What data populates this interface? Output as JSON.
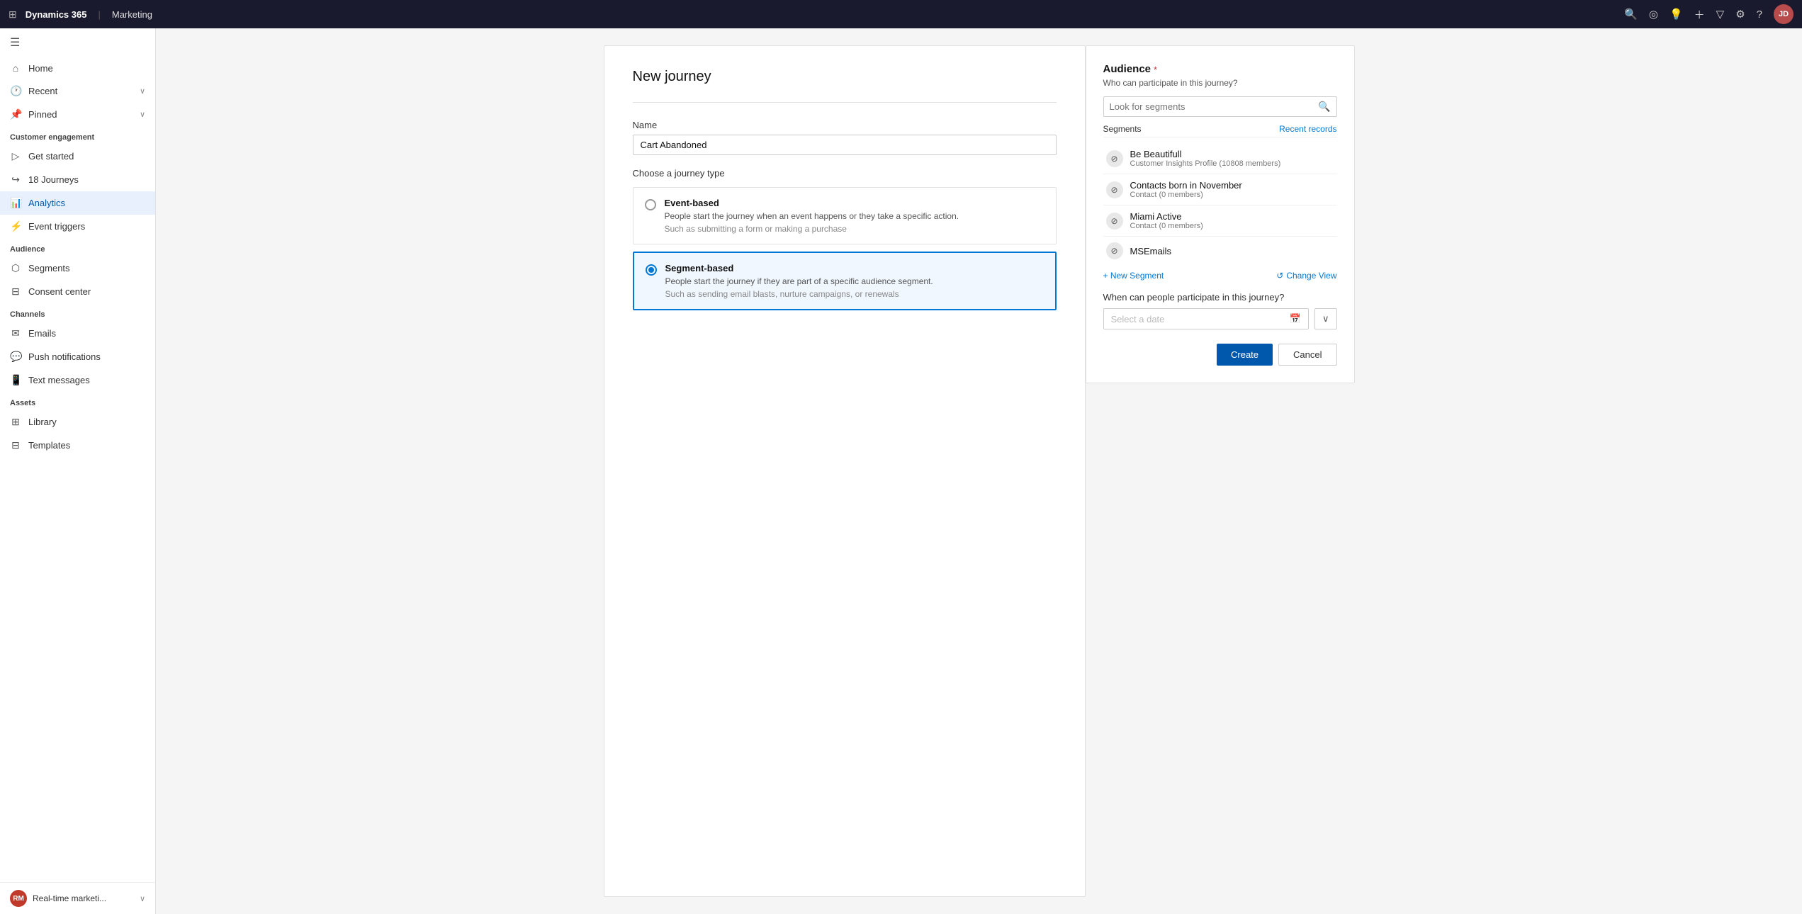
{
  "topbar": {
    "app_name": "Dynamics 365",
    "divider": "|",
    "module": "Marketing",
    "avatar_initials": "JD"
  },
  "sidebar": {
    "hamburger": "☰",
    "nav_items": [
      {
        "id": "home",
        "label": "Home",
        "icon": "⌂"
      },
      {
        "id": "recent",
        "label": "Recent",
        "icon": "⟳",
        "has_arrow": true
      },
      {
        "id": "pinned",
        "label": "Pinned",
        "icon": "📌",
        "has_arrow": true
      }
    ],
    "sections": [
      {
        "title": "Customer engagement",
        "items": [
          {
            "id": "get-started",
            "label": "Get started",
            "icon": "▷"
          },
          {
            "id": "journeys",
            "label": "18   Journeys",
            "icon": "↪"
          },
          {
            "id": "analytics",
            "label": "Analytics",
            "icon": "📊"
          },
          {
            "id": "event-triggers",
            "label": "Event triggers",
            "icon": "⚡"
          }
        ]
      },
      {
        "title": "Audience",
        "items": [
          {
            "id": "segments",
            "label": "Segments",
            "icon": "⬡"
          },
          {
            "id": "consent-center",
            "label": "Consent center",
            "icon": "⊟"
          }
        ]
      },
      {
        "title": "Channels",
        "items": [
          {
            "id": "emails",
            "label": "Emails",
            "icon": "✉"
          },
          {
            "id": "push-notifications",
            "label": "Push notifications",
            "icon": "💬"
          },
          {
            "id": "text-messages",
            "label": "Text messages",
            "icon": "📱"
          }
        ]
      },
      {
        "title": "Assets",
        "items": [
          {
            "id": "library",
            "label": "Library",
            "icon": "⊞"
          },
          {
            "id": "templates",
            "label": "Templates",
            "icon": "⊟"
          }
        ]
      }
    ],
    "bottom_avatar": "RM",
    "bottom_text": "Real-time marketi..."
  },
  "dialog": {
    "title": "New journey",
    "name_label": "Name",
    "name_value": "Cart Abandoned",
    "name_placeholder": "",
    "journey_type_label": "Choose a journey type",
    "options": [
      {
        "id": "event-based",
        "title": "Event-based",
        "desc": "People start the journey when an event happens or they take a specific action.",
        "example": "Such as submitting a form or making a purchase",
        "selected": false
      },
      {
        "id": "segment-based",
        "title": "Segment-based",
        "desc": "People start the journey if they are part of a specific audience segment.",
        "example": "Such as sending email blasts, nurture campaigns, or renewals",
        "selected": true
      }
    ]
  },
  "audience": {
    "title": "Audience",
    "required_marker": "*",
    "subtitle": "Who can participate in this journey?",
    "search_placeholder": "Look for segments",
    "tabs": {
      "segments": "Segments",
      "recent_records": "Recent records"
    },
    "segments": [
      {
        "id": "be-beautifull",
        "name": "Be Beautifull",
        "type": "Customer Insights Profile (10808 members)",
        "icon": "⊘"
      },
      {
        "id": "contacts-born-in-november",
        "name": "Contacts born in November",
        "type": "Contact (0 members)",
        "icon": "⊘"
      },
      {
        "id": "miami-active",
        "name": "Miami Active",
        "type": "Contact (0 members)",
        "icon": "⊘"
      },
      {
        "id": "msemails",
        "name": "MSEmails",
        "type": "",
        "icon": "⊘"
      }
    ],
    "new_segment_label": "+ New Segment",
    "change_view_label": "Change View",
    "when_label": "When can people participate in this journey?",
    "date_placeholder": "Select a date",
    "create_label": "Create",
    "cancel_label": "Cancel"
  }
}
